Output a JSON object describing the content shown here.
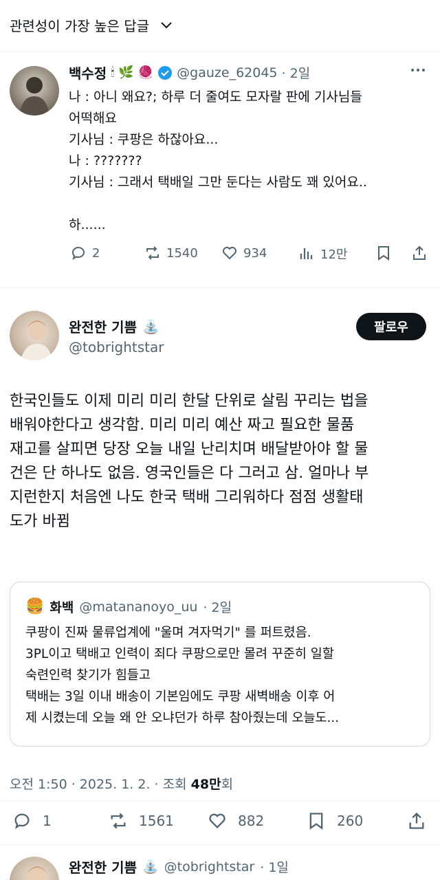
{
  "sort": {
    "label": "관련성이 가장 높은 답글"
  },
  "reply1": {
    "name": "백수정",
    "handle": "@gauze_62045",
    "time": "· 2일",
    "text": "나 : 아니 왜요?; 하루 더 줄여도 모자랄 판에 기사님들\n어떡해요\n기사님 : 쿠팡은 하잖아요...\n나 : ???????\n기사님 : 그래서 택배일 그만 둔다는 사람도 꽤 있어요..\n\n하......",
    "stats": {
      "replies": "2",
      "reposts": "1540",
      "likes": "934",
      "views": "12만"
    }
  },
  "main": {
    "name": "완전한 기쁨",
    "handle": "@tobrightstar",
    "follow_label": "팔로우",
    "text": "한국인들도 이제 미리 미리 한달 단위로 살림 꾸리는 법을\n배워야한다고 생각함. 미리 미리 예산 짜고 필요한 물품\n재고를 살피면 당장 오늘 내일 난리치며 배달받아야 할 물\n건은 단 하나도 없음. 영국인들은 다 그러고 삼. 얼마나 부\n지런한지 처음엔 나도 한국 택배 그리워하다 점점 생활태\n도가 바뀜",
    "quote": {
      "name": "화백",
      "handle": "@matananoyo_uu",
      "time": "· 2일",
      "text": "쿠팡이 진짜 물류업계에 \"울며 겨자먹기\" 를 퍼트렸음.\n3PL이고 택배고 인력이 죄다 쿠팡으로만 몰려 꾸준히 일할\n숙련인력 찾기가 힘들고\n택배는 3일 이내 배송이 기본임에도 쿠팡 새벽배송 이후 어\n제 시켰는데 오늘 왜 안 오냐던가 하루 참아줬는데 오늘도..."
    },
    "meta": {
      "time": "오전 1:50 · 2025. 1. 2. · 조회 ",
      "views": "48만",
      "views_suffix": "회"
    },
    "stats": {
      "replies": "1",
      "reposts": "1561",
      "likes": "882",
      "bookmarks": "260"
    }
  },
  "reply2": {
    "name": "완전한 기쁨",
    "handle": "@tobrightstar",
    "time": "· 1일"
  },
  "colors": {
    "verified": "#1d9bf0",
    "text": "#0f1419",
    "muted": "#536471",
    "border": "#cfd9de"
  }
}
